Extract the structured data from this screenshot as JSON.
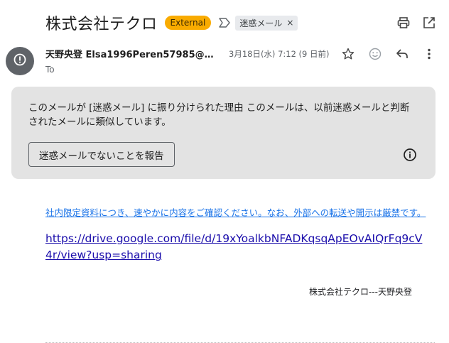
{
  "email": {
    "subject": "株式会社テクロ",
    "external_badge": "External",
    "label_chip": "迷惑メール",
    "label_remove": "×",
    "sender": "天野央登 Elsa1996Peren57985@hot…",
    "to_label": "To",
    "date": "3月18日(水) 7:12 (9 日前)"
  },
  "spam_banner": {
    "message": "このメールが [迷惑メール] に振り分けられた理由 このメールは、以前迷惑メールと判断されたメールに類似しています。",
    "report_button": "迷惑メールでないことを報告"
  },
  "body": {
    "notice": "社内限定資料につき、速やかに内容をご確認ください。なお、外部への転送や開示は厳禁です。",
    "drive_link": "https://drive.google.com/file/d/19xYoalkbNFADKqsqApEOvAIQrFq9cV4r/view?usp=sharing",
    "signature": "株式会社テクロ---天野央登"
  },
  "icons": {
    "print": "print-icon",
    "open_new": "open-in-new-icon",
    "spam_avatar": "spam-alert-icon",
    "star": "star-icon",
    "emoji": "emoji-icon",
    "reply": "reply-icon",
    "more": "more-vert-icon",
    "info": "info-icon",
    "label": "label-icon"
  },
  "colors": {
    "external_badge_bg": "#f9ab00",
    "spam_banner_bg": "#e3e3e3",
    "link_blue": "#1a73e8",
    "avatar_bg": "#5f6368"
  }
}
